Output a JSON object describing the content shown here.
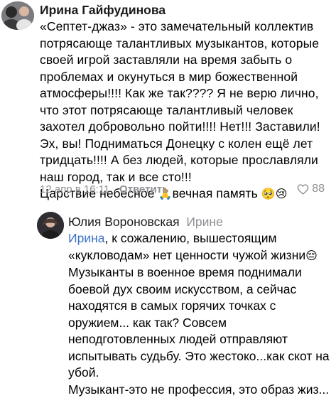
{
  "comment1": {
    "author": "Ирина Гайфудинова",
    "lines": [
      "«Септет-джаз» - это замечательный коллектив",
      "потрясающе талантливых музыкантов, которые",
      "своей игрой заставляли на время забыть о",
      "проблемах и окунуться в мир божественной",
      "атмосферы!!!! Как же так???? Я не верю лично,",
      "что этот потрясающе талантливый человек",
      "захотел добровольно пойти!!!! Нет!!! Заставили!",
      "Эх, вы! Подниматься Донецку с колен ещё лет",
      "тридцать!!!! А без людей, которые прославляли",
      "наш город, так и все сто!!!"
    ],
    "last_line_a": "Царствие небесное ",
    "emoji_pray": "🙏",
    "last_line_b": "вечная память ",
    "emoji_sad": "🥺😢",
    "timestamp": "12 апр в 16:11",
    "reply_label": "Ответить",
    "likes": "88"
  },
  "comment2": {
    "author": "Юлия Вороновская",
    "reply_to": "Ирине",
    "mention": "Ирина",
    "first_line_rest": ", к сожалению, вышестоящим",
    "line2": "«кукловодам» нет ценности чужой жизни",
    "emoji_pensive": "😔",
    "lines": [
      "Музыканты в военное время поднимали",
      "боевой дух своим искусством, а сейчас",
      "находятся в самых горячих точках с",
      "оружием... как так? Совсем",
      "неподготовленных людей отправляют",
      "испытывать судьбу. Это жестоко...как скот на",
      "убой.",
      "Музыкант-это не профессия, это образ жиз..."
    ]
  },
  "colors": {
    "meta": "#8e8e93",
    "link": "#3a73c9"
  },
  "icons": {
    "likes": "heart-outline-icon"
  }
}
